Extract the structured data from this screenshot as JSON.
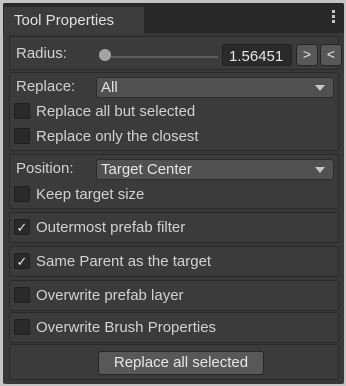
{
  "window": {
    "tab_title": "Tool Properties"
  },
  "radius": {
    "label": "Radius:",
    "value": "1.56451",
    "slider_fraction": 0.03,
    "increase_label": ">",
    "decrease_label": "<"
  },
  "replace": {
    "label": "Replace:",
    "selected": "All",
    "options": [
      {
        "label": "Replace all but selected",
        "checked": false
      },
      {
        "label": "Replace only the closest",
        "checked": false
      }
    ]
  },
  "position": {
    "label": "Position:",
    "selected": "Target Center",
    "keep_size_label": "Keep target size",
    "keep_size_checked": false
  },
  "filters": {
    "outermost_label": "Outermost prefab filter",
    "outermost_checked": true,
    "same_parent_label": "Same Parent as the target",
    "same_parent_checked": true,
    "overwrite_layer_label": "Overwrite prefab layer",
    "overwrite_layer_checked": false,
    "overwrite_brush_label": "Overwrite Brush Properties",
    "overwrite_brush_checked": false
  },
  "action": {
    "replace_selected_label": "Replace all selected"
  },
  "check_mark": "✓"
}
